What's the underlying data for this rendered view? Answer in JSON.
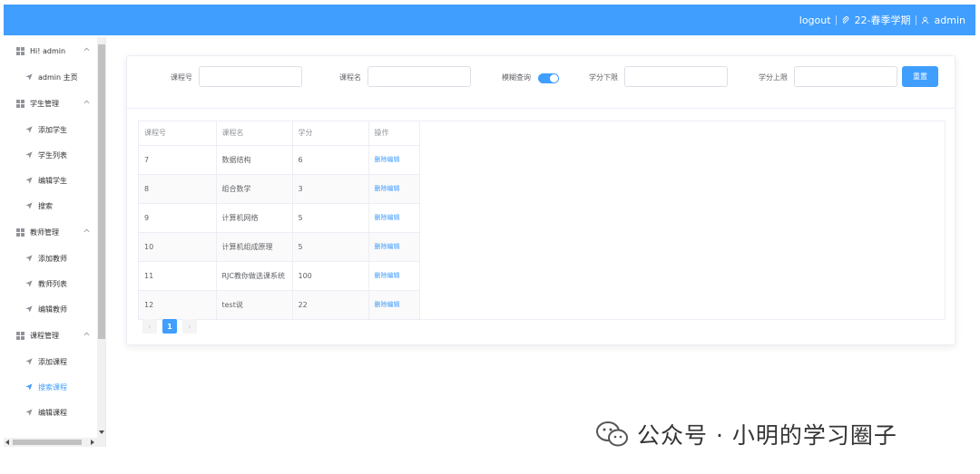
{
  "header": {
    "logout": "logout",
    "semester": "22-春季学期",
    "user": "admin"
  },
  "sidebar": {
    "groups": [
      {
        "title": "Hi! admin",
        "items": [
          "admin 主页"
        ]
      },
      {
        "title": "学生管理",
        "items": [
          "添加学生",
          "学生列表",
          "编辑学生",
          "搜索"
        ]
      },
      {
        "title": "教师管理",
        "items": [
          "添加教师",
          "教师列表",
          "编辑教师"
        ]
      },
      {
        "title": "课程管理",
        "items": [
          "添加课程",
          "搜索课程",
          "编辑课程"
        ]
      }
    ],
    "active_item": "搜索课程"
  },
  "search": {
    "course_id_label": "课程号",
    "course_name_label": "课程名",
    "fuzzy_label": "模糊查询",
    "fuzzy_on": true,
    "credit_min_label": "学分下限",
    "credit_max_label": "学分上限",
    "reset_label": "重置"
  },
  "table": {
    "headers": [
      "课程号",
      "课程名",
      "学分",
      "操作"
    ],
    "rows": [
      [
        "7",
        "数据结构",
        "6"
      ],
      [
        "8",
        "组合数学",
        "3"
      ],
      [
        "9",
        "计算机网络",
        "5"
      ],
      [
        "10",
        "计算机组成原理",
        "5"
      ],
      [
        "11",
        "RJC教你做选课系统",
        "100"
      ],
      [
        "12",
        "test说",
        "22"
      ]
    ],
    "delete_label": "删除",
    "edit_label": "编辑"
  },
  "pagination": {
    "prev": "‹",
    "current": "1",
    "next": "›"
  },
  "watermark": {
    "text": "公众号 · 小明的学习圈子"
  },
  "colors": {
    "primary": "#409eff",
    "header_bg": "#409eff"
  }
}
